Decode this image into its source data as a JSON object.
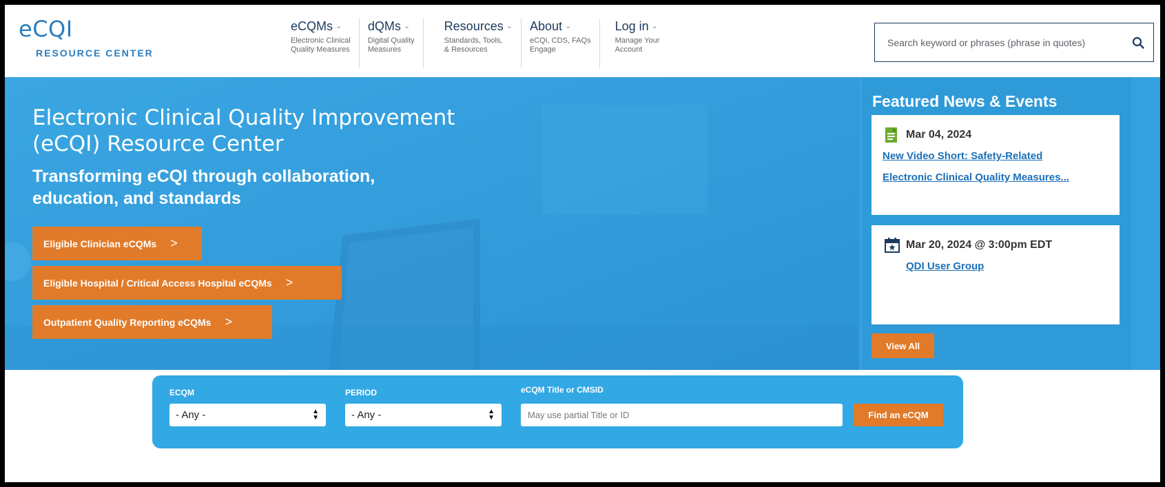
{
  "logo": {
    "main": "eCQI",
    "sub": "RESOURCE CENTER"
  },
  "nav": [
    {
      "title": "eCQMs",
      "sub": "Electronic Clinical\nQuality Measures"
    },
    {
      "title": "dQMs",
      "sub": "Digital Quality\nMeasures"
    },
    {
      "title": "Resources",
      "sub": "Standards, Tools,\n& Resources"
    },
    {
      "title": "About",
      "sub": "eCQI, CDS, FAQs\nEngage"
    },
    {
      "title": "Log in",
      "sub": "Manage Your\nAccount"
    }
  ],
  "search": {
    "placeholder": "Search keyword or phrases (phrase in quotes)"
  },
  "hero": {
    "title": "Electronic Clinical Quality Improvement (eCQI) Resource Center",
    "subtitle": "Transforming eCQI through collaboration, education, and standards",
    "buttons": [
      "Eligible Clinician eCQMs",
      "Eligible Hospital / Critical Access Hospital eCQMs",
      "Outpatient Quality Reporting eCQMs"
    ]
  },
  "news": {
    "title": "Featured News & Events",
    "items": [
      {
        "date": "Mar 04, 2024",
        "link_line1": "New Video Short: Safety-Related",
        "link_line2": "Electronic Clinical Quality Measures..."
      },
      {
        "date": "Mar 20, 2024 @ 3:00pm EDT",
        "link": "QDI User Group"
      }
    ],
    "view_all": "View All"
  },
  "finder": {
    "ecqm_label": "ECQM",
    "ecqm_value": "- Any -",
    "period_label": "PERIOD",
    "period_value": "- Any -",
    "title_label": "eCQM Title or CMSID",
    "title_placeholder": "May use partial Title or ID",
    "button": "Find an eCQM"
  },
  "colors": {
    "brand_blue": "#2c7dbd",
    "hero_blue": "#34a0de",
    "accent_orange": "#e17b2a",
    "nav_text": "#1b3a5c"
  }
}
